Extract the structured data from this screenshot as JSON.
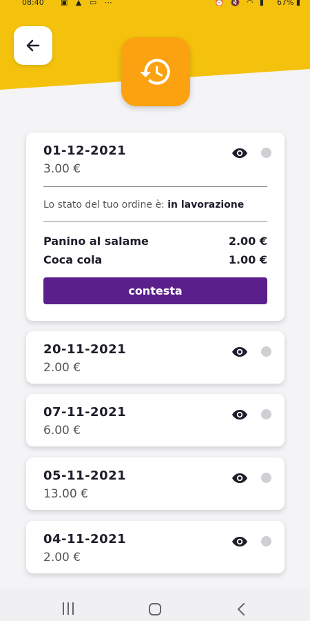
{
  "status_bar": {
    "time": "08:40",
    "battery": "67%",
    "left_icons": [
      "image-icon",
      "person-icon",
      "cast-icon",
      "more-icon"
    ],
    "right_icons": [
      "alarm-icon",
      "mute-icon",
      "wifi-icon",
      "signal-icon"
    ]
  },
  "header": {
    "back_icon": "arrow-left-icon",
    "badge_icon": "history-icon",
    "accent_yellow": "#f4c20d",
    "accent_orange": "#fca10f"
  },
  "orders": [
    {
      "date": "01-12-2021",
      "total": "3.00 €",
      "expanded": true,
      "status_label": "Lo stato del tuo ordine è: ",
      "status_value": "in lavorazione",
      "items": [
        {
          "name": "Panino al salame",
          "price": "2.00 €"
        },
        {
          "name": "Coca cola",
          "price": "1.00 €"
        }
      ],
      "action_label": "contesta"
    },
    {
      "date": "20-11-2021",
      "total": "2.00 €"
    },
    {
      "date": "07-11-2021",
      "total": "6.00 €"
    },
    {
      "date": "05-11-2021",
      "total": "13.00 €"
    },
    {
      "date": "04-11-2021",
      "total": "2.00 €"
    }
  ],
  "colors": {
    "button_purple": "#5b1f8b",
    "status_dot": "#cfcfd4"
  },
  "nav": [
    "recent-apps-icon",
    "home-icon",
    "back-icon"
  ]
}
